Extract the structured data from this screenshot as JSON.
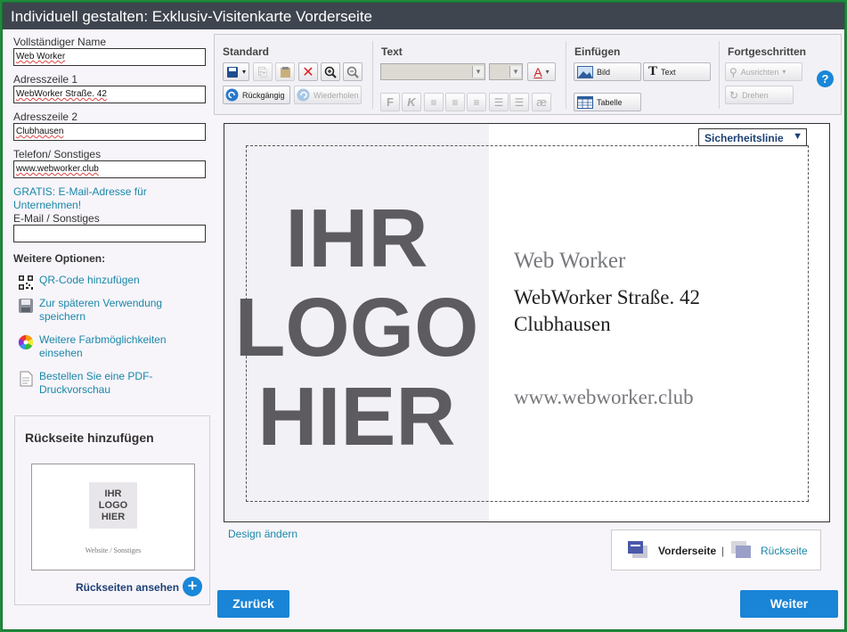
{
  "window": {
    "title": "Individuell gestalten: Exklusiv-Visitenkarte Vorderseite"
  },
  "form": {
    "name_label": "Vollständiger Name",
    "name_value": "Web Worker",
    "address1_label": "Adresszeile 1",
    "address1_value": "WebWorker Straße. 42",
    "address2_label": "Adresszeile 2",
    "address2_value": "Clubhausen",
    "phone_label": "Telefon/ Sonstiges",
    "phone_value": "www.webworker.club",
    "free_email_link": "GRATIS: E-Mail-Adresse für Unternehmen!",
    "email_label": "E-Mail / Sonstiges",
    "email_value": ""
  },
  "options": {
    "heading": "Weitere Optionen:",
    "items": [
      {
        "label": "QR-Code hinzufügen",
        "icon": "qr-code-icon"
      },
      {
        "label": "Zur späteren Verwendung speichern",
        "icon": "disk-icon"
      },
      {
        "label": "Weitere Farbmöglichkeiten einsehen",
        "icon": "color-wheel-icon"
      },
      {
        "label": "Bestellen Sie eine PDF-Druckvorschau",
        "icon": "document-icon"
      }
    ]
  },
  "back_side": {
    "title": "Rückseite hinzufügen",
    "thumb_logo": "IHR LOGO HIER",
    "thumb_sub": "Website / Sonstiges",
    "view_label": "Rückseiten ansehen",
    "plus": "+"
  },
  "toolbar": {
    "standard": {
      "title": "Standard",
      "undo": "Rückgängig",
      "redo": "Wiederholen"
    },
    "text": {
      "title": "Text",
      "bold": "F",
      "italic": "K",
      "special": "æ",
      "color": "A"
    },
    "insert": {
      "title": "Einfügen",
      "image": "Bild",
      "text": "Text",
      "table": "Tabelle"
    },
    "advanced": {
      "title": "Fortgeschritten",
      "align": "Ausrichten",
      "rotate": "Drehen"
    },
    "help": "?"
  },
  "card": {
    "logo_lines": [
      "IHR",
      "LOGO",
      "HIER"
    ],
    "safety_line": "Sicherheitslinie",
    "name": "Web Worker",
    "address1": "WebWorker Straße. 42",
    "address2": "Clubhausen",
    "website": "www.webworker.club"
  },
  "design_change": "Design ändern",
  "side_nav": {
    "front": "Vorderseite",
    "separator": "|",
    "back": "Rückseite"
  },
  "buttons": {
    "back": "Zurück",
    "next": "Weiter"
  },
  "colors": {
    "accent": "#1a84d6",
    "title_bar": "#3f454f",
    "frame": "#1f8a3c",
    "link": "#1a87a8"
  }
}
